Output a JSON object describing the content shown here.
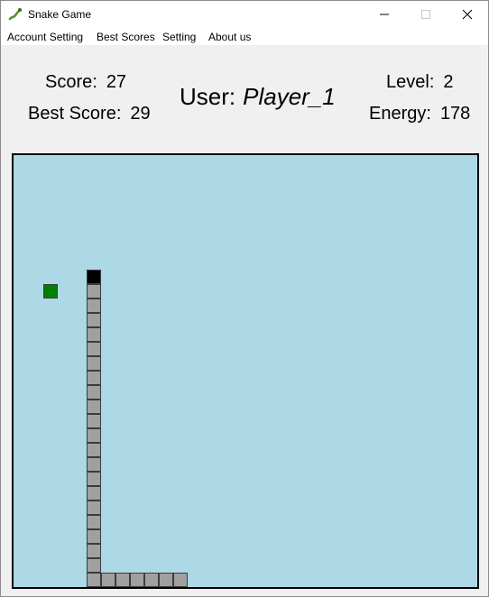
{
  "window": {
    "title": "Snake Game",
    "icon": "snake-icon"
  },
  "menu": {
    "items": [
      "Account Setting",
      "Best Scores",
      "Setting",
      "About us"
    ]
  },
  "stats": {
    "score_label": "Score:",
    "score_value": "27",
    "best_label": "Best Score:",
    "best_value": "29",
    "user_label": "User:",
    "user_name": "Player_1",
    "level_label": "Level:",
    "level_value": "2",
    "energy_label": "Energy:",
    "energy_value": "178"
  },
  "game": {
    "board_color": "#add8e6",
    "snake_body_color": "#a0a0a0",
    "snake_head_color": "#000000",
    "food_color": "#008000",
    "grid_cols": 32,
    "grid_rows": 30,
    "food": [
      2,
      9
    ],
    "snake_head": [
      5,
      8
    ],
    "snake_body": [
      [
        5,
        9
      ],
      [
        5,
        10
      ],
      [
        5,
        11
      ],
      [
        5,
        12
      ],
      [
        5,
        13
      ],
      [
        5,
        14
      ],
      [
        5,
        15
      ],
      [
        5,
        16
      ],
      [
        5,
        17
      ],
      [
        5,
        18
      ],
      [
        5,
        19
      ],
      [
        5,
        20
      ],
      [
        5,
        21
      ],
      [
        5,
        22
      ],
      [
        5,
        23
      ],
      [
        5,
        24
      ],
      [
        5,
        25
      ],
      [
        5,
        26
      ],
      [
        5,
        27
      ],
      [
        5,
        28
      ],
      [
        5,
        29
      ],
      [
        6,
        29
      ],
      [
        7,
        29
      ],
      [
        8,
        29
      ],
      [
        9,
        29
      ],
      [
        10,
        29
      ],
      [
        11,
        29
      ]
    ]
  }
}
